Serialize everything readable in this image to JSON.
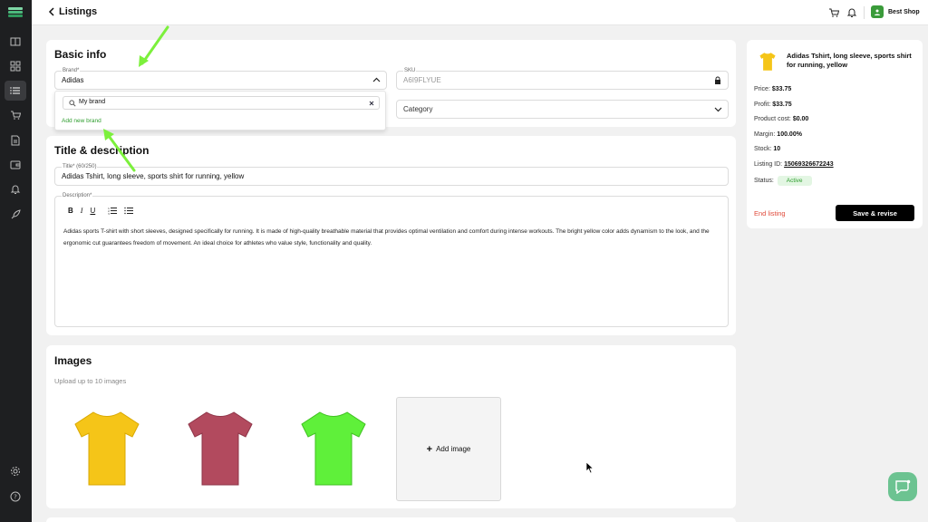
{
  "topbar": {
    "title": "Listings",
    "shop_name": "Best Shop"
  },
  "sidebar": {
    "items": [
      "book-icon",
      "grid-icon",
      "list-icon",
      "cart-icon",
      "document-icon",
      "wallet-icon",
      "bell-icon",
      "rocket-icon",
      "settings-icon",
      "help-icon"
    ]
  },
  "basic_info": {
    "heading": "Basic info",
    "brand_label": "Brand*",
    "brand_value": "Adidas",
    "sku_label": "SKU",
    "sku_value": "A6I9FLYUE",
    "category_placeholder": "Category",
    "brand_search_value": "My brand",
    "add_new_brand": "Add new brand"
  },
  "title_desc": {
    "heading": "Title & description",
    "title_label": "Title* (60/250)",
    "title_value": "Adidas Tshirt, long sleeve, sports shirt for running, yellow",
    "description_label": "Description*",
    "toolbar": [
      "B",
      "I",
      "U"
    ],
    "description_value": "Adidas sports T-shirt with short sleeves, designed specifically for running. It is made of high-quality breathable material that provides optimal ventilation and comfort during intense workouts. The bright yellow color adds dynamism to the look, and the ergonomic cut guarantees freedom of movement. An ideal choice for athletes who value style, functionality and quality."
  },
  "images": {
    "heading": "Images",
    "hint": "Upload up to 10 images",
    "add_label": "Add image",
    "colors": [
      "#f5c518",
      "#b24a5e",
      "#5ff03a"
    ]
  },
  "summary": {
    "product_title": "Adidas Tshirt, long sleeve, sports shirt for running, yellow",
    "price_label": "Price:",
    "price_value": "$33.75",
    "profit_label": "Profit:",
    "profit_value": "$33.75",
    "cost_label": "Product cost:",
    "cost_value": "$0.00",
    "margin_label": "Margin:",
    "margin_value": "100.00%",
    "stock_label": "Stock:",
    "stock_value": "10",
    "listing_id_label": "Listing ID:",
    "listing_id_value": "15069326672243",
    "status_label": "Status:",
    "status_value": "Active",
    "end_listing": "End listing",
    "save_revise": "Save & revise"
  },
  "colors": {
    "accent_green": "#2e9d2e",
    "danger": "#e04a3a",
    "annotation_arrow": "#7cf03c"
  }
}
